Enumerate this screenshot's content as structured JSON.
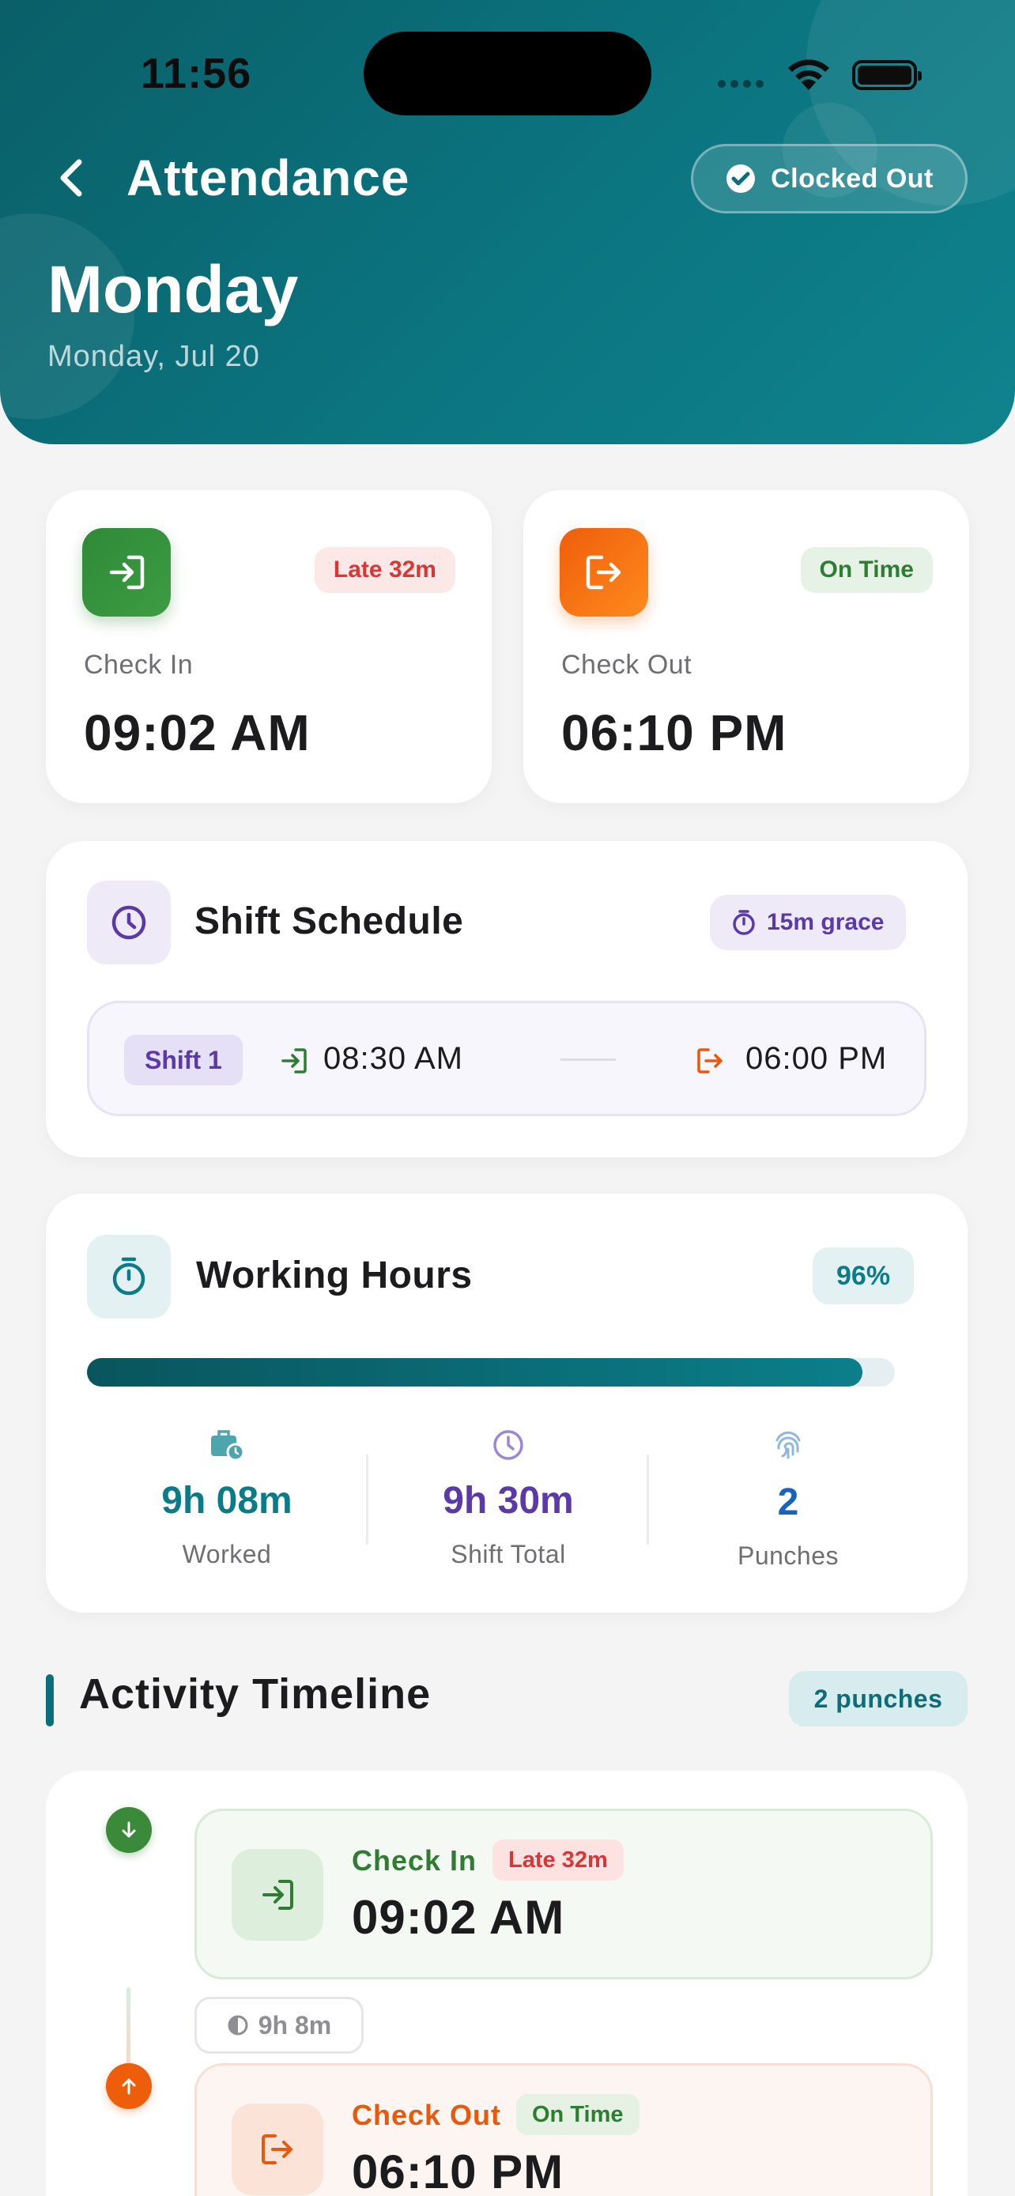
{
  "status_bar": {
    "time": "11:56"
  },
  "header": {
    "title": "Attendance",
    "status_pill": "Clocked Out",
    "day": "Monday",
    "date": "Monday, Jul 20",
    "gradient_colors": [
      "#0a5f68",
      "#0f838d"
    ]
  },
  "check_in_card": {
    "label": "Check In",
    "time": "09:02 AM",
    "badge": "Late 32m",
    "icon": "login-icon",
    "color": "#3a8a3a"
  },
  "check_out_card": {
    "label": "Check Out",
    "time": "06:10 PM",
    "badge": "On Time",
    "icon": "logout-icon",
    "color": "#f26b0f"
  },
  "shift_schedule": {
    "title": "Shift Schedule",
    "grace": "15m grace",
    "shift_label": "Shift 1",
    "start": "08:30 AM",
    "end": "06:00 PM"
  },
  "working_hours": {
    "title": "Working Hours",
    "percent_label": "96%",
    "progress": 0.96,
    "stats": [
      {
        "value": "9h 08m",
        "caption": "Worked",
        "icon": "briefcase-clock-icon",
        "color": "#0b7c87"
      },
      {
        "value": "9h 30m",
        "caption": "Shift Total",
        "icon": "clock-icon",
        "color": "#5b3aa8"
      },
      {
        "value": "2",
        "caption": "Punches",
        "icon": "fingerprint-icon",
        "color": "#1565c0"
      }
    ]
  },
  "timeline": {
    "title": "Activity Timeline",
    "count_label": "2 punches",
    "entries": [
      {
        "label": "Check In",
        "badge": "Late 32m",
        "time": "09:02 AM"
      },
      {
        "label": "Check Out",
        "badge": "On Time",
        "time": "06:10 PM"
      }
    ],
    "duration": "9h 8m"
  },
  "colors": {
    "accent": "#0b6f79",
    "late": "#d93636",
    "on_time": "#2e7d32",
    "purple": "#5b3aa8",
    "orange": "#e8590c"
  }
}
